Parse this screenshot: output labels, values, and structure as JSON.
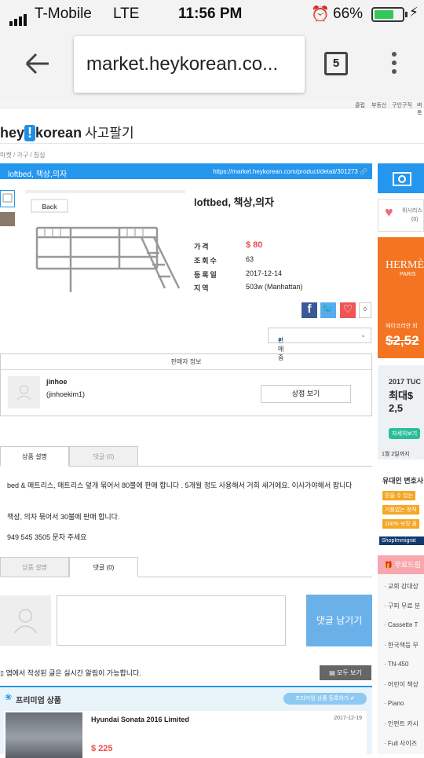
{
  "status_bar": {
    "carrier": "T-Mobile",
    "network": "LTE",
    "time": "11:56 PM",
    "battery": "66%",
    "battery_level": 0.66
  },
  "browser": {
    "url": "market.heykorean.co...",
    "tab_count": "5"
  },
  "header": {
    "top_links": [
      "클럽",
      "부동산",
      "구인구직",
      "벼룩"
    ],
    "logo": "hey!korean",
    "logo_sub": "사고팔기",
    "breadcrumb": "마켓 / 가구 / 침실"
  },
  "listing": {
    "bar_title": "loftbed, 책상,의자",
    "bar_url": "https://market.heykorean.com/product/detail/301273",
    "title": "loftbed, 책상,의자",
    "image_label": "Back",
    "specs": [
      {
        "key": "가격",
        "value": "$ 80"
      },
      {
        "key": "조회수",
        "value": "63"
      },
      {
        "key": "등록일",
        "value": "2017-12-14"
      },
      {
        "key": "지역",
        "value": "503w (Manhattan)"
      }
    ],
    "like_count": "0",
    "status": "판매중"
  },
  "seller": {
    "header": "판매자 정보",
    "name": "jinhoe",
    "id": "(jinhoekim1)",
    "detail_button": "상점 보기"
  },
  "tabs": {
    "description": "상품 설명",
    "comments": "댓글 (0)"
  },
  "description": [
    "bed & 매트리스, 매트리스 덮개 묶어서 80불에 판매 합니다 . 5개월 정도 사용해서 거희 새거에요. 이사가야해서 팝니다",
    "책상, 의자 묶어서 30불에 판매 합니다.",
    "949 545 3505 문자 주세요"
  ],
  "comment": {
    "submit": "댓글 남기기"
  },
  "notice": {
    "text": "앱에서 작성된 글은 실시간 알림이 가능합니다.",
    "view_all": "모두 보기"
  },
  "premium": {
    "title": "프리미엄 상품",
    "register": "프리미엄 상품 등록하기",
    "item": {
      "name": "Hyundai Sonata 2016 Limited",
      "date": "2017-12-19",
      "price": "$ 225"
    }
  },
  "sidebar": {
    "like_label": "위시리스",
    "like_count": "(0)",
    "hermes": {
      "brand": "HERMÈ",
      "city": "PARIS",
      "caption": "헤이코리안 회",
      "price": "$2,52"
    },
    "tuc": {
      "line1": "2017 TUC",
      "line2": "최대$ 2,5",
      "button": "자세히보기",
      "note": "1월 2일까지"
    },
    "imm": {
      "title": "유대인 변호사",
      "tags": [
        "믿을 수 있는",
        "거품없는 정직",
        "100% 보장 꼼"
      ],
      "brand": "ShopImmigrat"
    },
    "list_title": "무료드림",
    "list_items": [
      "교회 강대상",
      "구피 무료 분",
      "Cassette T",
      "한국책등 무",
      "TN-450",
      "어린이 책상",
      "Piano",
      "인펀트 카시",
      "Full 사이즈"
    ]
  }
}
